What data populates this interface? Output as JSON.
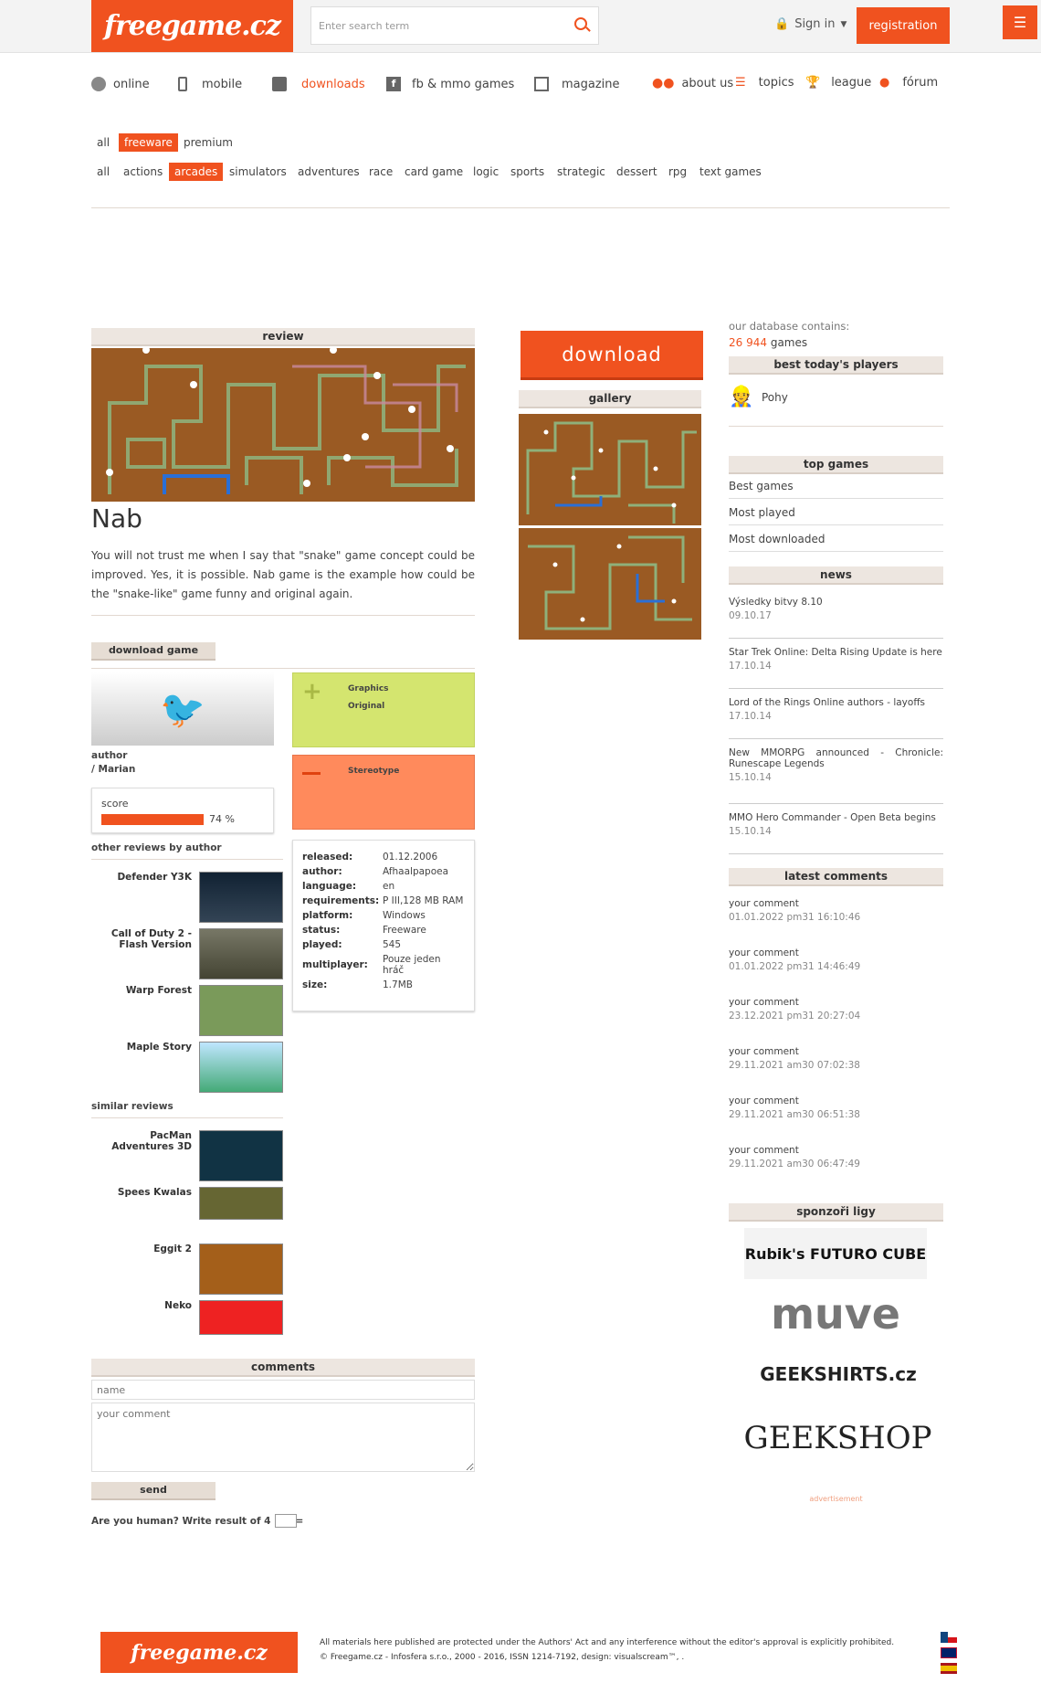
{
  "header": {
    "logo": "freegame.cz",
    "search_placeholder": "Enter search term",
    "signin": "Sign in",
    "registration": "registration"
  },
  "nav": [
    {
      "label": "online"
    },
    {
      "label": "mobile"
    },
    {
      "label": "downloads"
    },
    {
      "label": "fb & mmo games"
    },
    {
      "label": "magazine"
    }
  ],
  "nav_right": [
    {
      "label": "about us"
    },
    {
      "label": "topics"
    },
    {
      "label": "league"
    },
    {
      "label": "fórum"
    }
  ],
  "filters_1": [
    "all",
    "freeware",
    "premium"
  ],
  "filters_2": [
    "all",
    "actions",
    "arcades",
    "simulators",
    "adventures",
    "race",
    "card game",
    "logic",
    "sports",
    "strategic",
    "dessert",
    "rpg",
    "text games"
  ],
  "review": {
    "bar": "review",
    "title": "Nab",
    "text": "You will not trust me when I say that \"snake\" game concept could be improved. Yes, it is possible. Nab game is the example how could be the \"snake-like\" game funny and original again."
  },
  "download": {
    "button": "download",
    "gallery": "gallery",
    "download_game": "download game"
  },
  "pros": [
    "Graphics",
    "Original"
  ],
  "cons": [
    "Stereotype"
  ],
  "author": {
    "label": "author",
    "name": "/ Marian"
  },
  "score": {
    "label": "score",
    "value": "74 %",
    "percent": 74
  },
  "other_reviews_label": "other reviews by author",
  "other_reviews": [
    "Defender Y3K",
    "Call of Duty 2 - Flash Version",
    "Warp Forest",
    "Maple Story"
  ],
  "similar_reviews_label": "similar reviews",
  "similar_reviews": [
    "PacMan Adventures 3D",
    "Spees Kwalas",
    "Eggit 2",
    "Neko"
  ],
  "info": [
    {
      "k": "released:",
      "v": "01.12.2006"
    },
    {
      "k": "author:",
      "v": "Afhaalpapoea"
    },
    {
      "k": "language:",
      "v": "en"
    },
    {
      "k": "requirements:",
      "v": "P III,128 MB RAM"
    },
    {
      "k": "platform:",
      "v": "Windows"
    },
    {
      "k": "status:",
      "v": "Freeware"
    },
    {
      "k": "played:",
      "v": "545"
    },
    {
      "k": "multiplayer:",
      "v": "Pouze jeden hráč"
    },
    {
      "k": "size:",
      "v": "1.7MB"
    }
  ],
  "comments": {
    "bar": "comments",
    "name_placeholder": "name",
    "comment_placeholder": "your comment",
    "send": "send",
    "captcha": "Are you human? Write result of 4 + 3 ="
  },
  "sidebar": {
    "db_label": "our database contains:",
    "db_count": "26 944",
    "db_unit": "games",
    "best_players": "best today's players",
    "player": "Pohy",
    "top_games": "top games",
    "top_links": [
      "Best games",
      "Most played",
      "Most downloaded"
    ],
    "news_label": "news",
    "news": [
      {
        "t": "Výsledky bitvy 8.10",
        "d": "09.10.17"
      },
      {
        "t": "Star Trek Online: Delta Rising Update is here",
        "d": "17.10.14"
      },
      {
        "t": "Lord of the Rings Online authors - layoffs",
        "d": "17.10.14"
      },
      {
        "t": "New MMORPG announced - Chronicle: Runescape Legends",
        "d": "15.10.14"
      },
      {
        "t": "MMO Hero Commander - Open Beta begins",
        "d": "15.10.14"
      }
    ],
    "comments_label": "latest comments",
    "comments": [
      {
        "t": "your comment",
        "d": "01.01.2022 pm31 16:10:46"
      },
      {
        "t": "your comment",
        "d": "01.01.2022 pm31 14:46:49"
      },
      {
        "t": "your comment",
        "d": "23.12.2021 pm31 20:27:04"
      },
      {
        "t": "your comment",
        "d": "29.11.2021 am30 07:02:38"
      },
      {
        "t": "your comment",
        "d": "29.11.2021 am30 06:51:38"
      },
      {
        "t": "your comment",
        "d": "29.11.2021 am30 06:47:49"
      }
    ],
    "sponsors_label": "sponzoři ligy",
    "sponsors": [
      "Rubik's FUTURO CUBE",
      "muve",
      "GEEKSHIRTS.cz",
      "GEEKSHOP"
    ],
    "ad": "advertisement"
  },
  "footer": {
    "logo": "freegame.cz",
    "line1": "All materials here published are protected under the Authors' Act and any interference without the editor's approval is explicitly prohibited.",
    "line2": "© Freegame.cz - Infosfera s.r.o., 2000 - 2016, ISSN 1214-7192, design: visualscream™, ."
  },
  "colors": {
    "accent": "#f0521f",
    "pros": "#d4e56f",
    "cons": "#ff8a5c"
  }
}
